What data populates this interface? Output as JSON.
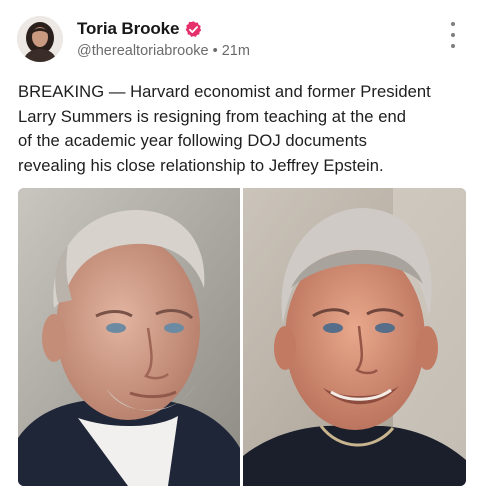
{
  "post": {
    "author": {
      "display_name": "Toria Brooke",
      "handle": "@therealtoriabrooke",
      "verified": true,
      "verified_color": "#e1306c"
    },
    "time_ago": "21m",
    "meta_separator": "•",
    "text_lines": [
      "BREAKING — Harvard economist and former President",
      "Larry Summers is resigning from teaching at the end",
      "of the academic year following DOJ documents",
      "revealing his close relationship to Jeffrey Epstein."
    ],
    "media": [
      {
        "kind": "photo",
        "subject": "older man with white hair, dark blazer"
      },
      {
        "kind": "photo",
        "subject": "smiling man with grey hair, dark jacket"
      }
    ],
    "more_icon": "vertical-ellipsis-icon"
  }
}
